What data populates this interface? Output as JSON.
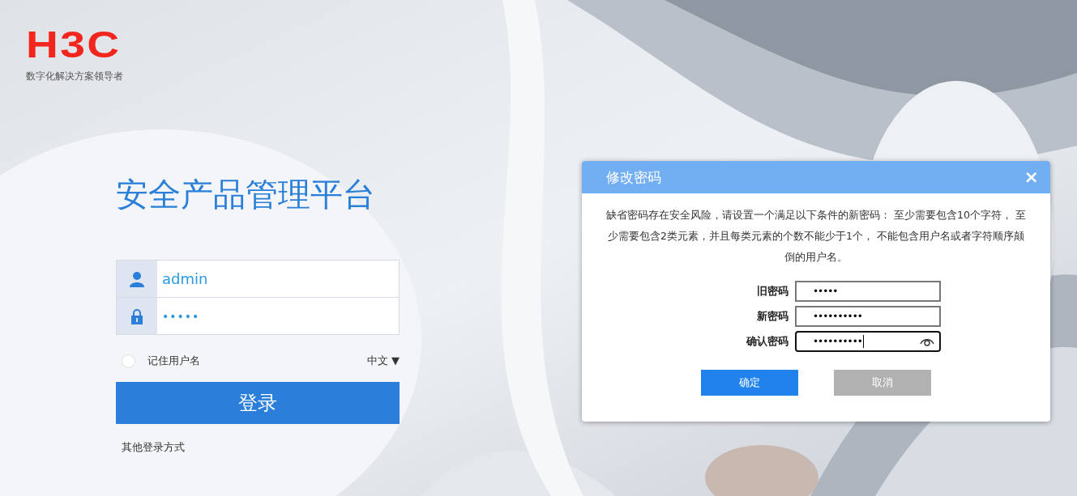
{
  "brand": {
    "logo": "H3C",
    "slogan": "数字化解决方案领导者"
  },
  "login": {
    "title": "安全产品管理平台",
    "fields": [
      {
        "kind": "user",
        "value": "admin"
      },
      {
        "kind": "password",
        "value": "•••••"
      }
    ],
    "remember": {
      "label": "记住用户名",
      "checked": false
    },
    "language": {
      "label": "中文",
      "caret": "▼"
    },
    "submit": "登录",
    "other": "其他登录方式"
  },
  "dialog": {
    "title": "修改密码",
    "close": "×",
    "message": "缺省密码存在安全风险，请设置一个满足以下条件的新密码： 至少需要包含10个字符， 至少需要包含2类元素，并且每类元素的个数不能少于1个， 不能包含用户名或者字符顺序颠倒的用户名。",
    "fields": [
      {
        "label": "旧密码",
        "value": "•••••",
        "focused": false
      },
      {
        "label": "新密码",
        "value": "••••••••••",
        "focused": false
      },
      {
        "label": "确认密码",
        "value": "••••••••••",
        "focused": true
      }
    ],
    "buttons": [
      {
        "label": "确定",
        "kind": "primary"
      },
      {
        "label": "取消",
        "kind": "secondary"
      }
    ]
  }
}
